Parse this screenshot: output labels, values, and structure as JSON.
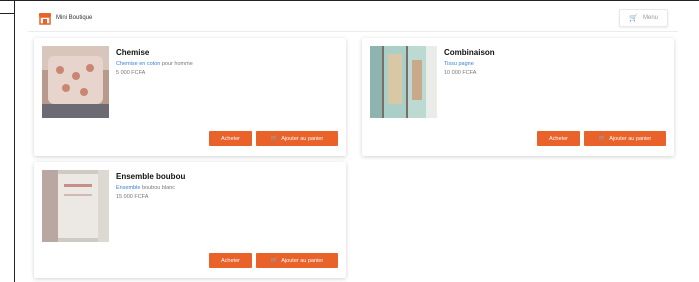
{
  "header": {
    "brand_name": "Mini Boutique",
    "top_button_label": "Menu"
  },
  "products": [
    {
      "title": "Chemise",
      "subtitle_link": "Chemise en coton",
      "subtitle_plain": "pour homme",
      "price": "5 000 FCFA",
      "buy_label": "Acheter",
      "cart_label": "Ajouter au panier"
    },
    {
      "title": "Combinaison",
      "subtitle_link": "Tissu pagne",
      "subtitle_plain": "",
      "price": "10 000 FCFA",
      "buy_label": "Acheter",
      "cart_label": "Ajouter au panier"
    },
    {
      "title": "Ensemble boubou",
      "subtitle_link": "Ensemble",
      "subtitle_plain": "boubou blanc",
      "price": "15 000 FCFA",
      "buy_label": "Acheter",
      "cart_label": "Ajouter au panier"
    }
  ],
  "colors": {
    "accent": "#e8622a",
    "link": "#3d7fd6"
  }
}
